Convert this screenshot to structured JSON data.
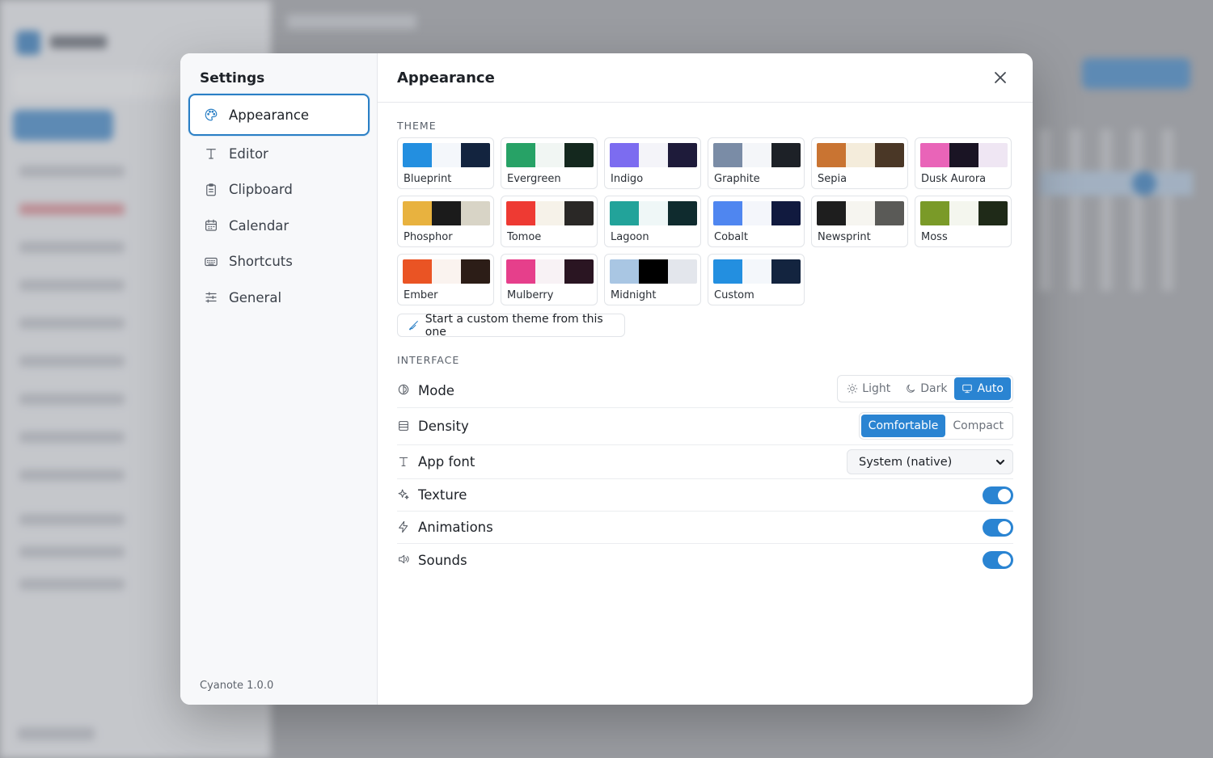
{
  "settings": {
    "title": "Settings",
    "version": "Cyanote 1.0.0",
    "nav": [
      {
        "label": "Appearance",
        "icon": "palette-icon",
        "active": true
      },
      {
        "label": "Editor",
        "icon": "text-icon"
      },
      {
        "label": "Clipboard",
        "icon": "clipboard-icon"
      },
      {
        "label": "Calendar",
        "icon": "calendar-icon"
      },
      {
        "label": "Shortcuts",
        "icon": "keyboard-icon"
      },
      {
        "label": "General",
        "icon": "sliders-icon"
      }
    ]
  },
  "panel": {
    "title": "Appearance",
    "theme_label": "THEME",
    "interface_label": "INTERFACE",
    "custom_button": "Start a custom theme from this one",
    "themes": [
      {
        "name": "Blueprint",
        "colors": [
          "#238fe0",
          "#f4f7fb",
          "#13243f"
        ]
      },
      {
        "name": "Evergreen",
        "colors": [
          "#27a266",
          "#f1f6f3",
          "#14281e"
        ]
      },
      {
        "name": "Indigo",
        "colors": [
          "#7c6cf0",
          "#f4f4f9",
          "#1e1b3a"
        ]
      },
      {
        "name": "Graphite",
        "colors": [
          "#7a8ca6",
          "#f4f6f9",
          "#1d2127"
        ]
      },
      {
        "name": "Sepia",
        "colors": [
          "#c97432",
          "#f4ecdb",
          "#4a3726"
        ]
      },
      {
        "name": "Dusk Aurora",
        "colors": [
          "#e964b8",
          "#1a1424",
          "#efe6f3"
        ]
      },
      {
        "name": "Phosphor",
        "colors": [
          "#e8b23f",
          "#1b1b1b",
          "#d8d4c6"
        ]
      },
      {
        "name": "Tomoe",
        "colors": [
          "#ee3a33",
          "#f6f2e9",
          "#2a2826"
        ]
      },
      {
        "name": "Lagoon",
        "colors": [
          "#22a39a",
          "#eff7f7",
          "#0f2b2e"
        ]
      },
      {
        "name": "Cobalt",
        "colors": [
          "#4f86f0",
          "#f4f6fb",
          "#111a3f"
        ]
      },
      {
        "name": "Newsprint",
        "colors": [
          "#1e1e1e",
          "#f6f5f0",
          "#5a5a57"
        ]
      },
      {
        "name": "Moss",
        "colors": [
          "#7a9a28",
          "#f4f6ee",
          "#1f2a18"
        ]
      },
      {
        "name": "Ember",
        "colors": [
          "#ea5424",
          "#faf3ef",
          "#2c1d17"
        ]
      },
      {
        "name": "Mulberry",
        "colors": [
          "#e63f8b",
          "#f8f2f5",
          "#2a1522"
        ]
      },
      {
        "name": "Midnight",
        "colors": [
          "#a9c6e3",
          "#000000",
          "#e3e6ec"
        ]
      },
      {
        "name": "Custom",
        "colors": [
          "#238fe0",
          "#f4f7fb",
          "#13243f"
        ]
      }
    ],
    "mode": {
      "label": "Mode",
      "options": [
        "Light",
        "Dark",
        "Auto"
      ],
      "selected": "Auto"
    },
    "density": {
      "label": "Density",
      "options": [
        "Comfortable",
        "Compact"
      ],
      "selected": "Comfortable"
    },
    "font": {
      "label": "App font",
      "value": "System (native)"
    },
    "texture": {
      "label": "Texture",
      "on": true
    },
    "animations": {
      "label": "Animations",
      "on": true
    },
    "sounds": {
      "label": "Sounds",
      "on": true
    },
    "accent_color": "#2a84d2"
  }
}
